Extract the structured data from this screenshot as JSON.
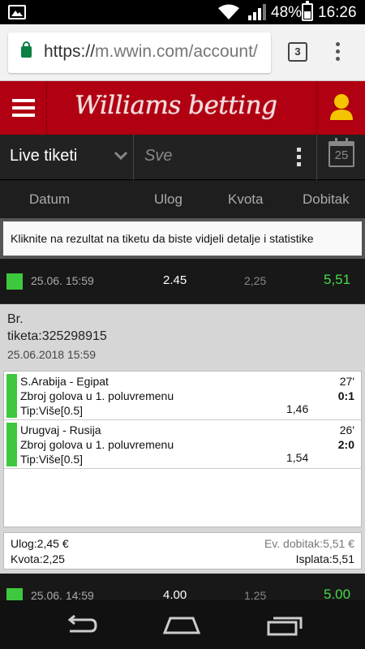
{
  "status_bar": {
    "battery": "48%",
    "time": "16:26",
    "icons": [
      "gallery-icon",
      "wifi-icon",
      "signal-icon",
      "battery-icon"
    ]
  },
  "browser": {
    "url_scheme": "https://",
    "url_rest": "m.wwin.com/account/",
    "tab_count": "3"
  },
  "header": {
    "logo_text": "Williams betting"
  },
  "filter": {
    "selected": "Live tiketi",
    "search_placeholder": "Sve",
    "calendar_day": "25"
  },
  "columns": {
    "date": "Datum",
    "stake": "Ulog",
    "odds": "Kvota",
    "win": "Dobitak"
  },
  "info_message": "Kliknite na rezultat na tiketu da biste vidjeli detalje i statistike",
  "tickets": [
    {
      "date": "25.06. 15:59",
      "stake": "2.45",
      "odds": "2,25",
      "win": "5,51"
    },
    {
      "date": "25.06. 14:59",
      "stake": "4.00",
      "odds": "1.25",
      "win": "5.00"
    }
  ],
  "detail": {
    "ticket_label_1": "Br.",
    "ticket_label_2": "tiketa:325298915",
    "datetime": "25.06.2018 15:59",
    "matches": [
      {
        "teams": "S.Arabija - Egipat",
        "market": "Zbroj golova u 1. poluvremenu",
        "tip": "Tip:Više[0.5]",
        "odds": "1,46",
        "minute": "27'",
        "score": "0:1"
      },
      {
        "teams": "Urugvaj - Rusija",
        "market": "Zbroj golova u 1. poluvremenu",
        "tip": "Tip:Više[0.5]",
        "odds": "1,54",
        "minute": "26'",
        "score": "2:0"
      }
    ],
    "summary": {
      "stake": "Ulog:2,45 €",
      "odds": "Kvota:2,25",
      "potential_win": "Ev. dobitak:5,51 €",
      "payout": "Isplata:5,51"
    }
  },
  "colors": {
    "brand_red": "#b00011",
    "win_green": "#49d949",
    "status_green": "#3ec83e"
  }
}
